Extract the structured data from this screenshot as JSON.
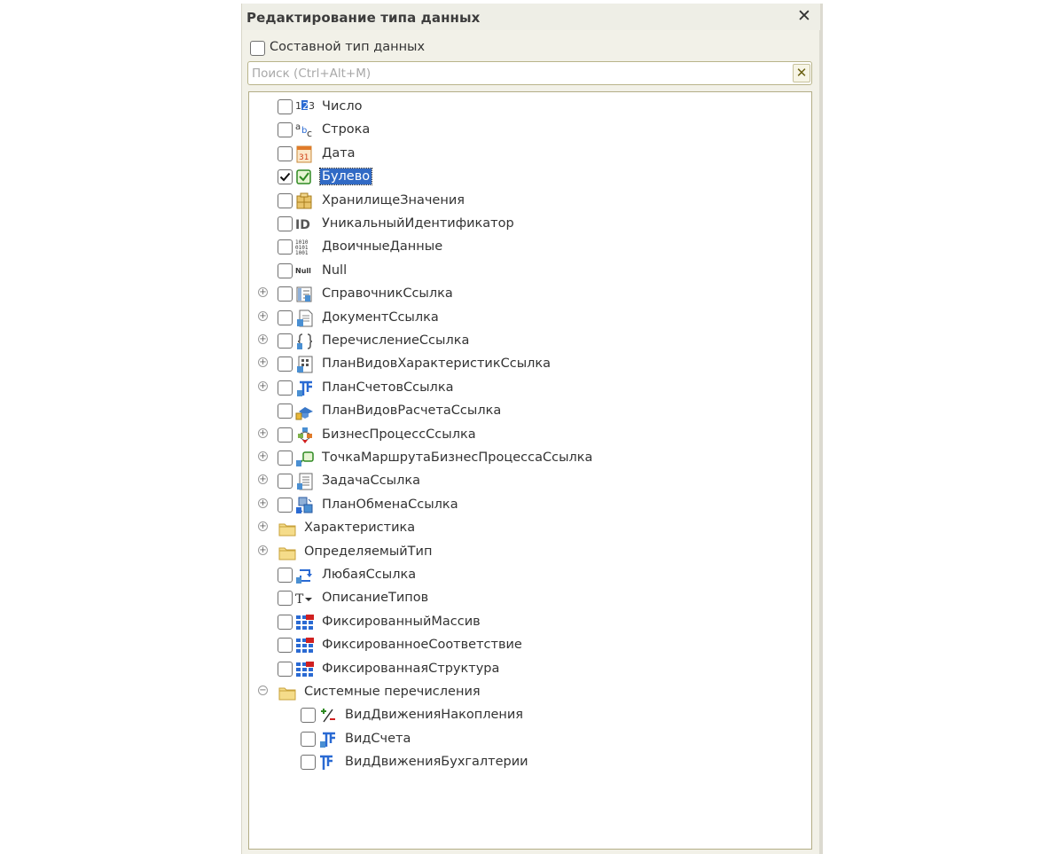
{
  "dialog": {
    "title": "Редактирование типа данных",
    "close_glyph": "✕"
  },
  "composite": {
    "label": "Составной тип данных",
    "checked": false
  },
  "search": {
    "placeholder": "Поиск (Ctrl+Alt+M)",
    "value": "",
    "clear_glyph": "✕"
  },
  "tree": {
    "items": [
      {
        "label": "Число",
        "icon": "number-icon",
        "checked": false,
        "expander": "none",
        "level": 0
      },
      {
        "label": "Строка",
        "icon": "string-icon",
        "checked": false,
        "expander": "none",
        "level": 0
      },
      {
        "label": "Дата",
        "icon": "calendar-icon",
        "checked": false,
        "expander": "none",
        "level": 0
      },
      {
        "label": "Булево",
        "icon": "boolean-icon",
        "checked": true,
        "selected": true,
        "expander": "none",
        "level": 0
      },
      {
        "label": "ХранилищеЗначения",
        "icon": "value-storage-icon",
        "checked": false,
        "expander": "none",
        "level": 0
      },
      {
        "label": "УникальныйИдентификатор",
        "icon": "uuid-icon",
        "checked": false,
        "expander": "none",
        "level": 0
      },
      {
        "label": "ДвоичныеДанные",
        "icon": "binary-data-icon",
        "checked": false,
        "expander": "none",
        "level": 0
      },
      {
        "label": "Null",
        "icon": "null-icon",
        "checked": false,
        "expander": "none",
        "level": 0
      },
      {
        "label": "СправочникСсылка",
        "icon": "catalog-ref-icon",
        "checked": false,
        "expander": "plus",
        "level": 0
      },
      {
        "label": "ДокументСсылка",
        "icon": "document-ref-icon",
        "checked": false,
        "expander": "plus",
        "level": 0
      },
      {
        "label": "ПеречислениеСсылка",
        "icon": "enum-ref-icon",
        "checked": false,
        "expander": "plus",
        "level": 0
      },
      {
        "label": "ПланВидовХарактеристикСсылка",
        "icon": "chart-of-characteristic-types-icon",
        "checked": false,
        "expander": "plus",
        "level": 0
      },
      {
        "label": "ПланСчетовСсылка",
        "icon": "chart-of-accounts-icon",
        "checked": false,
        "expander": "plus",
        "level": 0
      },
      {
        "label": "ПланВидовРасчетаСсылка",
        "icon": "chart-of-calculation-types-icon",
        "checked": false,
        "expander": "none",
        "level": 0
      },
      {
        "label": "БизнесПроцессСсылка",
        "icon": "business-process-icon",
        "checked": false,
        "expander": "plus",
        "level": 0
      },
      {
        "label": "ТочкаМаршрутаБизнесПроцессаСсылка",
        "icon": "route-point-icon",
        "checked": false,
        "expander": "plus",
        "level": 0
      },
      {
        "label": "ЗадачаСсылка",
        "icon": "task-ref-icon",
        "checked": false,
        "expander": "plus",
        "level": 0
      },
      {
        "label": "ПланОбменаСсылка",
        "icon": "exchange-plan-icon",
        "checked": false,
        "expander": "plus",
        "level": 0
      },
      {
        "label": "Характеристика",
        "icon": "folder-icon",
        "checked": null,
        "expander": "plus",
        "level": 0
      },
      {
        "label": "ОпределяемыйТип",
        "icon": "folder-icon",
        "checked": null,
        "expander": "plus",
        "level": 0
      },
      {
        "label": "ЛюбаяСсылка",
        "icon": "any-ref-icon",
        "checked": false,
        "expander": "none",
        "level": 0
      },
      {
        "label": "ОписаниеТипов",
        "icon": "type-description-icon",
        "checked": false,
        "expander": "none",
        "level": 0
      },
      {
        "label": "ФиксированныйМассив",
        "icon": "fixed-collection-icon",
        "checked": false,
        "expander": "none",
        "level": 0
      },
      {
        "label": "ФиксированноеСоответствие",
        "icon": "fixed-collection-icon",
        "checked": false,
        "expander": "none",
        "level": 0
      },
      {
        "label": "ФиксированнаяСтруктура",
        "icon": "fixed-collection-icon",
        "checked": false,
        "expander": "none",
        "level": 0
      },
      {
        "label": "Системные перечисления",
        "icon": "folder-icon",
        "checked": null,
        "expander": "minus",
        "level": 0
      },
      {
        "label": "ВидДвиженияНакопления",
        "icon": "accumulation-movement-icon",
        "checked": false,
        "expander": "none",
        "level": 1
      },
      {
        "label": "ВидСчета",
        "icon": "account-type-icon",
        "checked": false,
        "expander": "none",
        "level": 1
      },
      {
        "label": "ВидДвиженияБухгалтерии",
        "icon": "accounting-movement-icon",
        "checked": false,
        "expander": "none",
        "level": 1
      }
    ]
  },
  "colors": {
    "dialog_bg": "#f2f1e8",
    "selection": "#316ac5",
    "border": "#b3ad86",
    "text": "#333333"
  }
}
